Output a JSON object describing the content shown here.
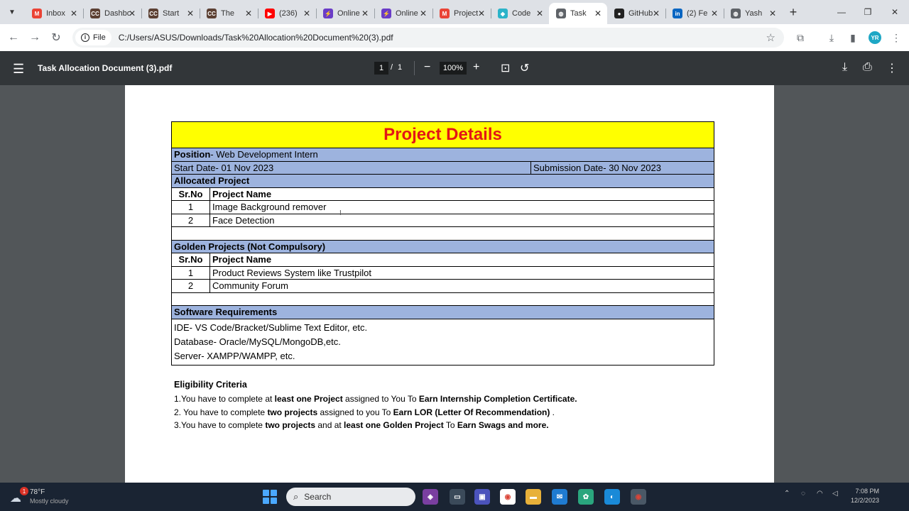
{
  "tabs": [
    {
      "title": "Inbox",
      "icon": "gmail-icon",
      "color": "#ea4335",
      "glyph": "M"
    },
    {
      "title": "Dashboard",
      "icon": "codeclause-icon",
      "color": "#5c4033",
      "glyph": "CC"
    },
    {
      "title": "Start",
      "icon": "codeclause-icon",
      "color": "#5c4033",
      "glyph": "CC"
    },
    {
      "title": "The",
      "icon": "codeclause-icon",
      "color": "#5c4033",
      "glyph": "CC"
    },
    {
      "title": "(236)",
      "icon": "youtube-icon",
      "color": "#ff0000",
      "glyph": "▶"
    },
    {
      "title": "Online",
      "icon": "bolt-icon",
      "color": "#6a3cc7",
      "glyph": "⚡"
    },
    {
      "title": "Online",
      "icon": "bolt-icon",
      "color": "#6a3cc7",
      "glyph": "⚡"
    },
    {
      "title": "Project",
      "icon": "gmail-icon",
      "color": "#ea4335",
      "glyph": "M"
    },
    {
      "title": "Code",
      "icon": "codepen-icon",
      "color": "#2bb3c9",
      "glyph": "◆"
    },
    {
      "title": "Task",
      "icon": "globe-icon",
      "color": "#5f6368",
      "glyph": "◍",
      "active": true
    },
    {
      "title": "GitHub",
      "icon": "github-icon",
      "color": "#222222",
      "glyph": "●"
    },
    {
      "title": "(2) Fe",
      "icon": "linkedin-icon",
      "color": "#0a66c2",
      "glyph": "in"
    },
    {
      "title": "Yash",
      "icon": "globe-icon",
      "color": "#5f6368",
      "glyph": "◍"
    }
  ],
  "toolbar": {
    "chip_label": "File",
    "url": "C:/Users/ASUS/Downloads/Task%20Allocation%20Document%20(3).pdf",
    "avatar_initials": "YR"
  },
  "pdf_toolbar": {
    "title": "Task Allocation Document (3).pdf",
    "page_current": "1",
    "page_separator": "/",
    "page_total": "1",
    "zoom": "100%"
  },
  "document": {
    "heading": "Project Details",
    "position_label": "Position",
    "position_value": "- Web Development Intern",
    "start_date": "Start Date- 01 Nov 2023",
    "submission_date": "Submission Date- 30 Nov 2023",
    "allocated_header": "Allocated Project",
    "col_srno": "Sr.No",
    "col_project": "Project Name",
    "allocated_projects": [
      {
        "sr": "1",
        "name": "Image Background remover"
      },
      {
        "sr": "2",
        "name": "Face Detection"
      }
    ],
    "golden_header": "Golden Projects (Not Compulsory)",
    "golden_projects": [
      {
        "sr": "1",
        "name": "Product Reviews System like Trustpilot"
      },
      {
        "sr": "2",
        "name": "Community Forum"
      }
    ],
    "software_header": "Software Requirements",
    "software_lines": [
      "IDE- VS Code/Bracket/Sublime Text Editor, etc.",
      "Database- Oracle/MySQL/MongoDB,etc.",
      "Server- XAMPP/WAMPP, etc."
    ],
    "eligibility_header": "Eligibility Criteria",
    "eligibility": [
      {
        "a": "1.You have to complete at ",
        "b": "least one Project",
        "c": " assigned to You To ",
        "d": "Earn Internship Completion Certificate.",
        "e": ""
      },
      {
        "a": "2. You have to complete ",
        "b": "two projects",
        "c": " assigned to you To ",
        "d": "Earn LOR (Letter Of Recommendation)",
        "e": " ."
      },
      {
        "a": "3.You have to complete ",
        "b": "two projects",
        "c": " and at ",
        "d": "least one Golden Project",
        "e": " To ",
        "f": "Earn Swags and more."
      }
    ]
  },
  "taskbar": {
    "weather_temp": "78°F",
    "weather_desc": "Mostly cloudy",
    "weather_badge": "1",
    "search_label": "Search",
    "clock_time": "7:08 PM",
    "clock_date": "12/2/2023"
  }
}
